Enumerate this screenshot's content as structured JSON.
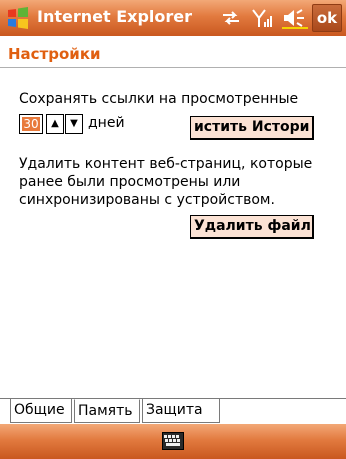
{
  "titlebar": {
    "app_title": "Internet Explorer",
    "ok_label": "ok",
    "icons": [
      "windows-start-icon",
      "connectivity-icon",
      "signal-strength-icon",
      "volume-icon"
    ]
  },
  "page": {
    "title": "Настройки"
  },
  "history": {
    "label": "Сохранять ссылки на просмотренные",
    "days_value": "30",
    "days_unit": "дней",
    "clear_button": "истить Истори"
  },
  "cache": {
    "label_line1": "Удалить контент веб-страниц, которые",
    "label_line2": "ранее были просмотрены или",
    "label_line3": "синхронизированы с устройством.",
    "delete_button": "Удалить файль"
  },
  "tabs": [
    {
      "label": "Общие"
    },
    {
      "label": "Память"
    },
    {
      "label": "Защита"
    }
  ],
  "bottombar": {
    "icons": [
      "keyboard-icon"
    ]
  },
  "colors": {
    "accent": "#e05f10",
    "bar": "#e27a3f",
    "button_bg": "#fbe2d4"
  }
}
